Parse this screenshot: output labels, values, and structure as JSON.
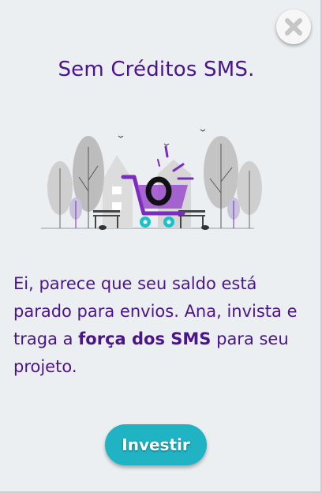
{
  "modal": {
    "title": "Sem Créditos SMS.",
    "message_parts": [
      "Ei, parece que seu saldo está parado para envios. Ana, invista e traga a ",
      "força dos SMS",
      " para seu projeto."
    ],
    "primary_button_label": "Investir",
    "close_icon": "close-icon",
    "illustration_icon": "shopping-cart-illustration"
  },
  "colors": {
    "title": "#4b148b",
    "button": "#1fb3c4",
    "background": "#eceff1",
    "accent_purple": "#7b2cbf",
    "accent_teal": "#19c2c9"
  }
}
